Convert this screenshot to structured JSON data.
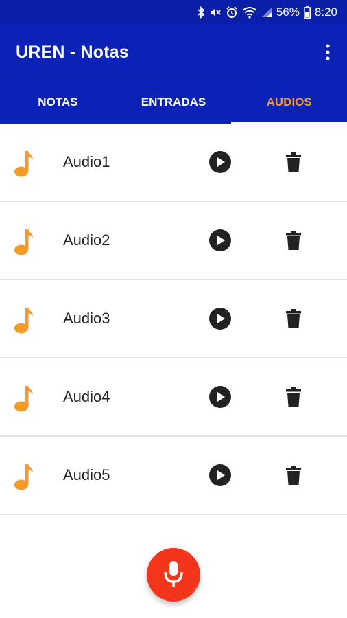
{
  "status_bar": {
    "battery": "56%",
    "time": "8:20",
    "icons": [
      "bluetooth-icon",
      "mute-icon",
      "alarm-icon",
      "wifi-icon",
      "signal-icon",
      "battery-icon"
    ]
  },
  "app_bar": {
    "title": "UREN - Notas",
    "overflow_icon": "more-vert-icon"
  },
  "tabs": [
    {
      "label": "NOTAS",
      "active": false
    },
    {
      "label": "ENTRADAS",
      "active": false
    },
    {
      "label": "AUDIOS",
      "active": true
    }
  ],
  "audios": [
    {
      "label": "Audio1"
    },
    {
      "label": "Audio2"
    },
    {
      "label": "Audio3"
    },
    {
      "label": "Audio4"
    },
    {
      "label": "Audio5"
    }
  ],
  "fab": {
    "icon": "microphone-icon"
  },
  "colors": {
    "primary": "#0a22b6",
    "accent": "#f39a28",
    "fab": "#f2351b",
    "icon_dark": "#222222"
  }
}
